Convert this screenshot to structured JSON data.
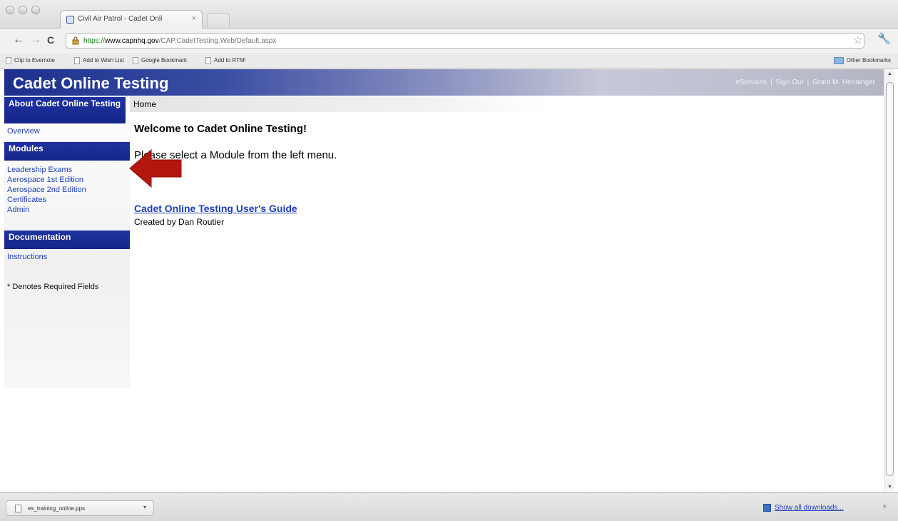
{
  "browser": {
    "tab_title": "Civil Air Patrol - Cadet Onli",
    "tab_close": "×",
    "url_scheme": "https://",
    "url_host": "www.capnhq.gov",
    "url_path": "/CAP.CadetTesting.Web/Default.aspx",
    "nav": {
      "back": "←",
      "forward": "→",
      "reload": "C"
    },
    "star": "☆",
    "wrench": "🔧",
    "bookmarks": [
      "Clip to Evernote",
      "Add to Wish List",
      "Google Bookmark",
      "Add to RTM!"
    ],
    "other_bookmarks": "Other Bookmarks"
  },
  "header": {
    "title": "Cadet Online Testing",
    "links": [
      "eServices",
      "Sign Out",
      "Grant M. Henninger"
    ],
    "separator": "|"
  },
  "sidebar": {
    "about_heading": "About Cadet Online Testing",
    "about_links": [
      "Overview"
    ],
    "modules_heading": "Modules",
    "module_links": [
      "Leadership Exams",
      "Aerospace 1st Edition",
      "Aerospace 2nd Edition",
      "Certificates",
      "Admin"
    ],
    "documentation_heading": "Documentation",
    "documentation_links": [
      "Instructions"
    ],
    "required_note": "* Denotes Required Fields"
  },
  "main": {
    "breadcrumb": "Home",
    "welcome": "Welcome to Cadet Online Testing!",
    "message": "Please select a Module from the left menu.",
    "guide_link": "Cadet Online Testing User's Guide",
    "guide_credit": "Created by Dan Routier"
  },
  "downloads": {
    "file_name": "es_training_online.pps",
    "menu": "▾",
    "show_all": "Show all downloads...",
    "close": "×"
  },
  "colors": {
    "header_dark": "#1c2f8d",
    "sidebar_heading": "#1e33a0",
    "link": "#1d3fbb",
    "annotation_arrow": "#b3170e"
  },
  "icons": {
    "annotation_arrow": "left-pointing-red-arrow"
  }
}
